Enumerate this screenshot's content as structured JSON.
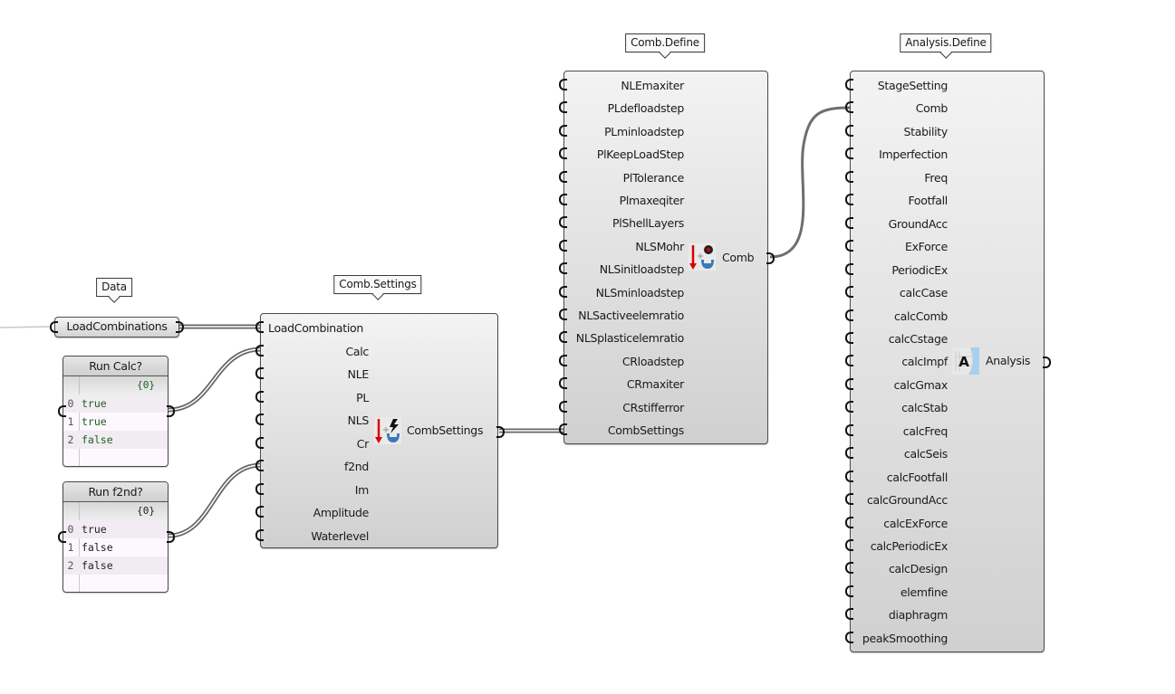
{
  "canvas": {
    "wire_color": "#6e6e6e",
    "panel_green": "#1f5f1f"
  },
  "data_param": {
    "tag": "Data",
    "label": "LoadCombinations"
  },
  "panels": [
    {
      "title": "Run Calc?",
      "path": "{0}",
      "text_color": "#1f5f1f",
      "rows": [
        {
          "index": "0",
          "value": "true"
        },
        {
          "index": "1",
          "value": "true"
        },
        {
          "index": "2",
          "value": "false"
        }
      ]
    },
    {
      "title": "Run f2nd?",
      "path": "{0}",
      "text_color": "#222222",
      "rows": [
        {
          "index": "0",
          "value": "true"
        },
        {
          "index": "1",
          "value": "false"
        },
        {
          "index": "2",
          "value": "false"
        }
      ]
    }
  ],
  "comb_settings": {
    "tag": "Comb.Settings",
    "inputs": [
      "LoadCombination",
      "Calc",
      "NLE",
      "PL",
      "NLS",
      "Cr",
      "f2nd",
      "Im",
      "Amplitude",
      "Waterlevel"
    ],
    "output": "CombSettings",
    "icon": "comb-settings-icon"
  },
  "comb_define": {
    "tag": "Comb.Define",
    "inputs": [
      "NLEmaxiter",
      "PLdefloadstep",
      "PLminloadstep",
      "PlKeepLoadStep",
      "PlTolerance",
      "Plmaxeqiter",
      "PlShellLayers",
      "NLSMohr",
      "NLSinitloadstep",
      "NLSminloadstep",
      "NLSactiveelemratio",
      "NLSplasticelemratio",
      "CRloadstep",
      "CRmaxiter",
      "CRstifferror",
      "CombSettings"
    ],
    "output": "Comb",
    "icon": "comb-define-icon"
  },
  "analysis_define": {
    "tag": "Analysis.Define",
    "inputs": [
      "StageSetting",
      "Comb",
      "Stability",
      "Imperfection",
      "Freq",
      "Footfall",
      "GroundAcc",
      "ExForce",
      "PeriodicEx",
      "calcCase",
      "calcComb",
      "calcCstage",
      "calcImpf",
      "calcGmax",
      "calcStab",
      "calcFreq",
      "calcSeis",
      "calcFootfall",
      "calcGroundAcc",
      "calcExForce",
      "calcPeriodicEx",
      "calcDesign",
      "elemfine",
      "diaphragm",
      "peakSmoothing"
    ],
    "output": "Analysis",
    "icon": "analysis-define-icon"
  }
}
